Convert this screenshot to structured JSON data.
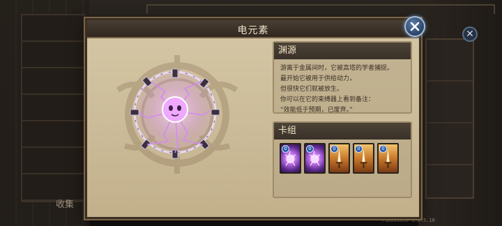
{
  "background": {
    "left_tab_label": "收集",
    "build_id": "PID222658 1.0.5.10"
  },
  "modal": {
    "title": "电元素",
    "close_icon": "close-x-icon",
    "description_panel": {
      "header": "渊源",
      "lines": [
        "游离于金属间时，它被高塔的学者捕捉。",
        "最开始它被用于供给动力，",
        "但很快它们就被放生。",
        "你可以在它的束缚器上看到备注：",
        "“效能低于预期，已废弃。”"
      ]
    },
    "deck_panel": {
      "header": "卡组",
      "cards": [
        {
          "cost": "0",
          "art": "electric-orb"
        },
        {
          "cost": "0",
          "art": "electric-orb"
        },
        {
          "cost": "0",
          "art": "golden-sword"
        },
        {
          "cost": "0",
          "art": "golden-sword"
        },
        {
          "cost": "0",
          "art": "golden-sword"
        }
      ]
    }
  },
  "colors": {
    "accent_purple": "#c676ef",
    "parchment": "#d5c7a6",
    "title_bar": "#3a3129"
  }
}
